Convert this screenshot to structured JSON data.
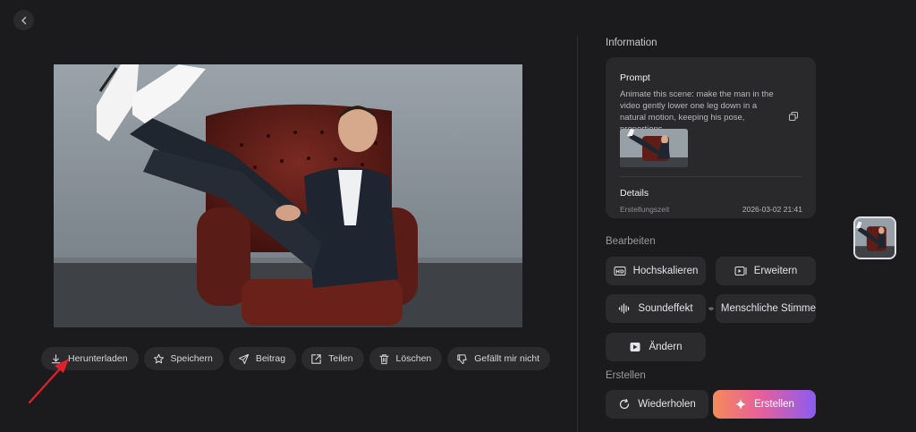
{
  "toolbar": {
    "download": "Herunterladen",
    "save": "Speichern",
    "post": "Beitrag",
    "share": "Teilen",
    "delete": "Löschen",
    "dislike": "Gefällt mir nicht"
  },
  "info": {
    "title": "Information",
    "prompt_label": "Prompt",
    "prompt_text": "Animate this scene: make the man in the video gently lower one leg down in a natural motion, keeping his pose, proportions,...",
    "details_label": "Details",
    "details": [
      {
        "key": "Erstellungszeit",
        "value": "2026-03-02 21:41"
      }
    ]
  },
  "edit": {
    "label": "Bearbeiten",
    "buttons": [
      "Hochskalieren",
      "Erweitern",
      "Soundeffekt",
      "Menschliche Stimme",
      "Ändern"
    ]
  },
  "create": {
    "label": "Erstellen",
    "repeat": "Wiederholen",
    "create": "Erstellen"
  },
  "colors": {
    "background": "#1b1b1d",
    "panel": "#29292c",
    "button": "#2b2b2e",
    "accent_gradient_start": "#f48a5a",
    "accent_gradient_end": "#8a5cf0",
    "annotation_arrow": "#e0202a"
  },
  "icons": [
    "chevron-left-icon",
    "download-icon",
    "star-icon",
    "send-icon",
    "share-icon",
    "trash-icon",
    "thumbs-down-icon",
    "copy-icon",
    "hd-icon",
    "expand-video-icon",
    "waveform-icon",
    "lips-icon",
    "edit-video-icon",
    "refresh-icon",
    "sparkle-icon"
  ]
}
